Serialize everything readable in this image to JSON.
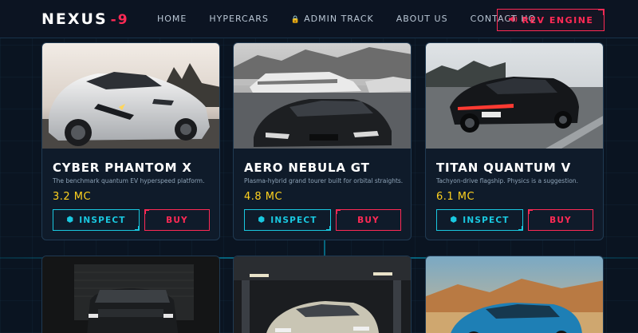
{
  "nav": {
    "logo_main": "NEXUS",
    "logo_accent": "-9",
    "links": [
      {
        "label": "HOME"
      },
      {
        "label": "HYPERCARS"
      },
      {
        "label": "ADMIN TRACK",
        "icon": "lock-icon"
      },
      {
        "label": "ABOUT US"
      },
      {
        "label": "CONTACT HQ"
      }
    ],
    "cta_label": "REV ENGINE",
    "cta_icon": "speaker-icon"
  },
  "colors": {
    "accent_red": "#ff2a55",
    "accent_cyan": "#19c8e0",
    "price_yellow": "#ffd21f",
    "background": "#0a1421"
  },
  "cards": [
    {
      "name": "CYBER PHANTOM X",
      "description": "The benchmark quantum EV hyperspeed platform.",
      "price": "3.2 MC",
      "inspect_label": "INSPECT",
      "buy_label": "BUY",
      "photo": "white-supercar-photo"
    },
    {
      "name": "AERO NEBULA GT",
      "description": "Plasma-hybrid grand tourer built for orbital straights.",
      "price": "4.8 MC",
      "inspect_label": "INSPECT",
      "buy_label": "BUY",
      "photo": "black-coupe-harbor-photo"
    },
    {
      "name": "TITAN QUANTUM V",
      "description": "Tachyon-drive flagship. Physics is a suggestion.",
      "price": "6.1 MC",
      "inspect_label": "INSPECT",
      "buy_label": "BUY",
      "photo": "black-sedan-road-photo"
    }
  ],
  "second_row": [
    {
      "photo": "black-suv-garage-photo"
    },
    {
      "photo": "silver-sedan-garage-photo"
    },
    {
      "photo": "blue-muscle-car-desert-photo"
    }
  ]
}
